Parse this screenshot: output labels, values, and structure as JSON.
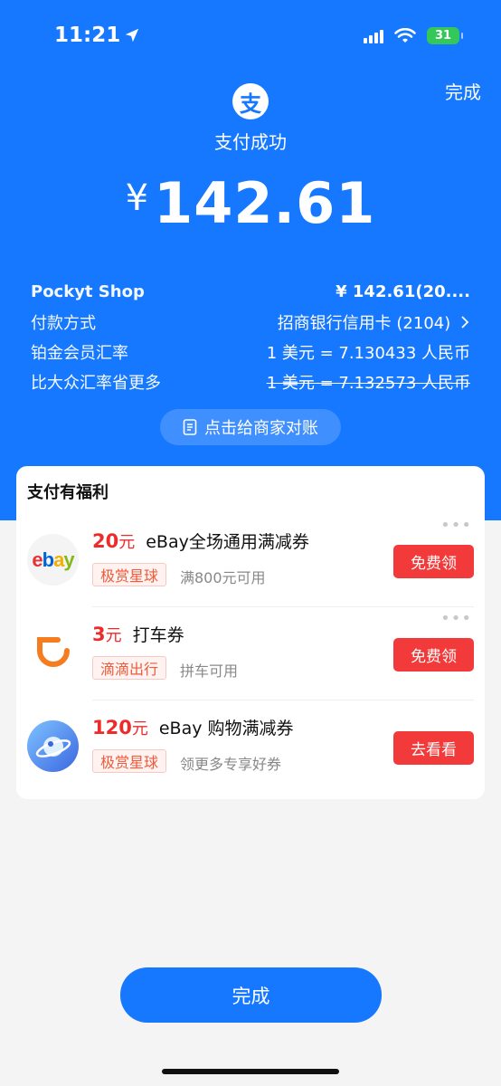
{
  "status_bar": {
    "time": "11:21",
    "battery": "31"
  },
  "header": {
    "done_label": "完成",
    "logo_char": "支",
    "status_text": "支付成功",
    "currency": "¥",
    "amount": "142.61"
  },
  "details": {
    "rows": [
      {
        "label": "Pockyt Shop",
        "value": "¥ 142.61(20...."
      },
      {
        "label": "付款方式",
        "value": "招商银行信用卡 (2104)"
      },
      {
        "label": "铂金会员汇率",
        "value": "1 美元 = 7.130433 人民币"
      },
      {
        "label": "比大众汇率省更多",
        "value": "1 美元 = 7.132573 人民币"
      }
    ]
  },
  "reconcile_label": "点击给商家对账",
  "benefits": {
    "title": "支付有福利",
    "offers": [
      {
        "price": "20",
        "unit": "元",
        "name": "eBay全场通用满减券",
        "tag": "极赏星球",
        "note": "满800元可用",
        "button": "免费领",
        "icon": "ebay-logo-icon"
      },
      {
        "price": "3",
        "unit": "元",
        "name": "打车券",
        "tag": "滴滴出行",
        "note": "拼车可用",
        "button": "免费领",
        "icon": "didi-logo-icon"
      },
      {
        "price": "120",
        "unit": "元",
        "name": "eBay 购物满减券",
        "tag": "极赏星球",
        "note": "领更多专享好券",
        "button": "去看看",
        "icon": "planet-logo-icon"
      }
    ]
  },
  "bottom_done_label": "完成",
  "colors": {
    "brand_blue": "#1677ff",
    "accent_red": "#f23a3a",
    "page_bg": "#f4f4f5"
  }
}
